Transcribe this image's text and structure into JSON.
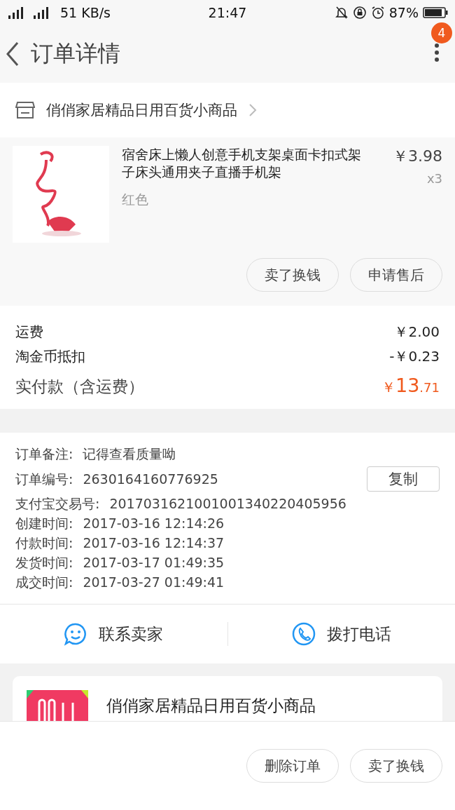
{
  "status_bar": {
    "network": "51 KB/s",
    "time": "21:47",
    "battery": "87%"
  },
  "header": {
    "title": "订单详情",
    "menu_badge": "4"
  },
  "shop": {
    "name": "俏俏家居精品日用百货小商品"
  },
  "product": {
    "title": "宿舍床上懒人创意手机支架桌面卡扣式架子床头通用夹子直播手机架",
    "variant": "红色",
    "price": "￥3.98",
    "quantity": "x3",
    "actions": [
      "卖了换钱",
      "申请售后"
    ]
  },
  "fees": [
    {
      "label": "运费",
      "value": "￥2.00"
    },
    {
      "label": "淘金币抵扣",
      "value": "-￥0.23"
    }
  ],
  "total": {
    "label": "实付款（含运费）",
    "currency": "￥",
    "integer": "13",
    "decimal": ".71"
  },
  "info": [
    {
      "label": "订单备注:",
      "value": "记得查看质量呦"
    },
    {
      "label": "订单编号:",
      "value": "2630164160776925",
      "action": "复制"
    },
    {
      "label": "支付宝交易号:",
      "value": "2017031621001001340220405956"
    },
    {
      "label": "创建时间:",
      "value": "2017-03-16 12:14:26"
    },
    {
      "label": "付款时间:",
      "value": "2017-03-16 12:14:37"
    },
    {
      "label": "发货时间:",
      "value": "2017-03-17 01:49:35"
    },
    {
      "label": "成交时间:",
      "value": "2017-03-27 01:49:41"
    }
  ],
  "contact": [
    {
      "kind": "chat",
      "label": "联系卖家"
    },
    {
      "kind": "phone",
      "label": "拨打电话"
    }
  ],
  "shop_card": {
    "name": "俏俏家居精品日用百货小商品"
  },
  "bottom_actions": [
    "删除订单",
    "卖了换钱"
  ]
}
